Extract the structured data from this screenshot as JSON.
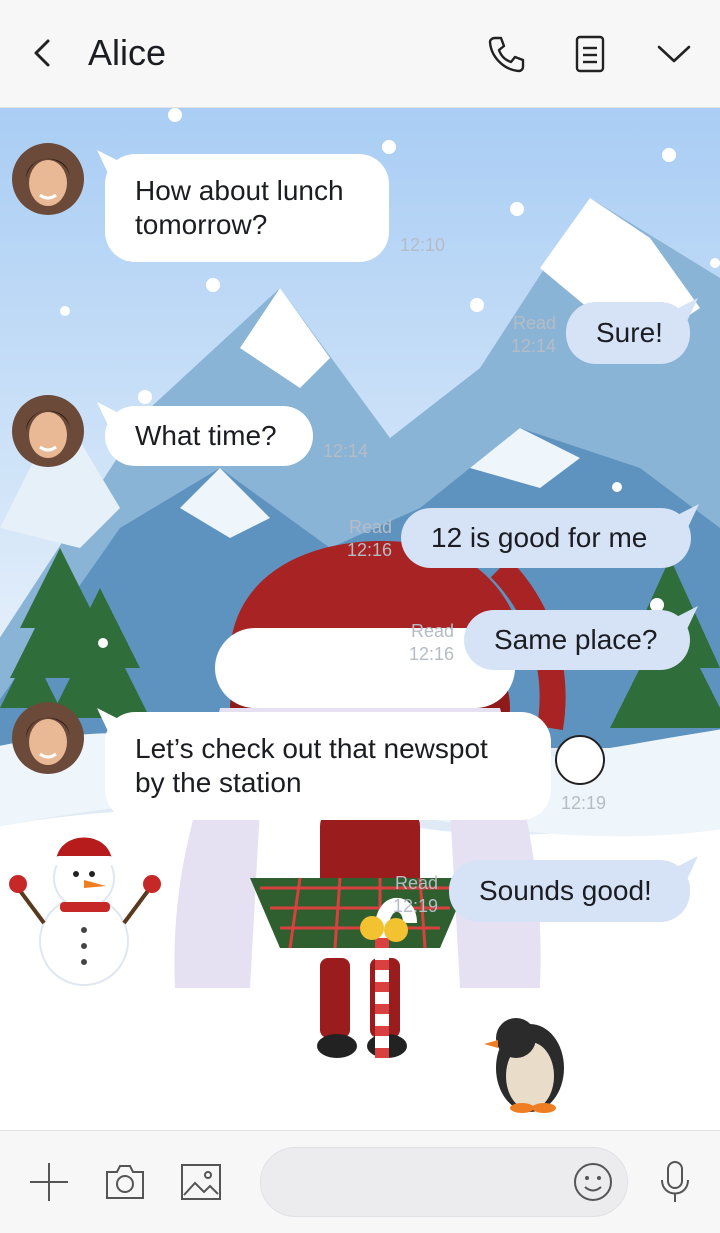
{
  "header": {
    "title": "Alice",
    "icons": [
      "back-chevron-icon",
      "phone-icon",
      "notes-icon",
      "chevron-down-icon"
    ]
  },
  "messages": [
    {
      "from": "them",
      "text_line1": "How about lunch",
      "text_line2": "tomorrow?",
      "time": "12:10"
    },
    {
      "from": "me",
      "text": "Sure!",
      "read": "Read",
      "time": "12:14"
    },
    {
      "from": "them",
      "text": "What time?",
      "time": "12:14"
    },
    {
      "from": "me",
      "text": "12 is good for me",
      "read": "Read",
      "time": "12:16"
    },
    {
      "from": "me",
      "text": "Same place?",
      "read": "Read",
      "time": "12:16"
    },
    {
      "from": "them",
      "text_line1": "Let’s check out that newspot",
      "text_line2": "by the station",
      "time": "12:19"
    },
    {
      "from": "me",
      "text": "Sounds good!",
      "read": "Read",
      "time": "12:19"
    }
  ],
  "footer": {
    "icons": [
      "plus-icon",
      "camera-icon",
      "image-icon",
      "emoji-icon",
      "microphone-icon"
    ],
    "input_placeholder": ""
  },
  "colors": {
    "header_bg": "#f7f7f8",
    "my_bubble": "#d6e2f6",
    "their_bubble": "#ffffff",
    "meta_text": "#b6bcc6"
  }
}
